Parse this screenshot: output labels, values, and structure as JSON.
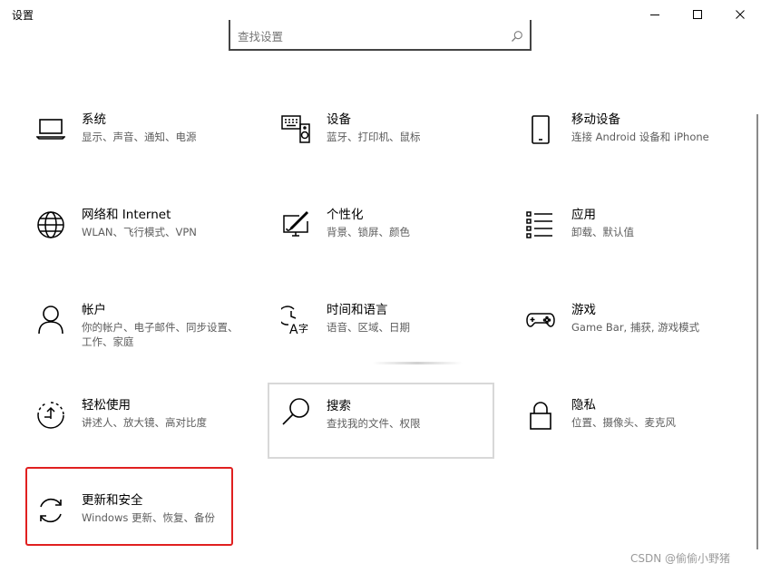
{
  "window": {
    "title": "设置",
    "minimize_icon": "minimize-icon",
    "maximize_icon": "maximize-icon",
    "close_icon": "close-icon"
  },
  "search": {
    "placeholder": "查找设置",
    "value": "",
    "icon": "search-icon"
  },
  "categories": [
    {
      "name": "系统",
      "desc": "显示、声音、通知、电源",
      "icon": "laptop-icon"
    },
    {
      "name": "设备",
      "desc": "蓝牙、打印机、鼠标",
      "icon": "keyboard-speaker-icon"
    },
    {
      "name": "移动设备",
      "desc": "连接 Android 设备和 iPhone",
      "icon": "phone-icon"
    },
    {
      "name": "网络和 Internet",
      "desc": "WLAN、飞行模式、VPN",
      "icon": "globe-icon"
    },
    {
      "name": "个性化",
      "desc": "背景、锁屏、颜色",
      "icon": "paint-monitor-icon"
    },
    {
      "name": "应用",
      "desc": "卸载、默认值",
      "icon": "apps-list-icon"
    },
    {
      "name": "帐户",
      "desc": "你的帐户、电子邮件、同步设置、工作、家庭",
      "icon": "person-icon"
    },
    {
      "name": "时间和语言",
      "desc": "语音、区域、日期",
      "icon": "time-language-icon"
    },
    {
      "name": "游戏",
      "desc": "Game Bar, 捕获, 游戏模式",
      "icon": "gamepad-icon"
    },
    {
      "name": "轻松使用",
      "desc": "讲述人、放大镜、高对比度",
      "icon": "ease-of-access-icon"
    },
    {
      "name": "搜索",
      "desc": "查找我的文件、权限",
      "icon": "magnifier-icon"
    },
    {
      "name": "隐私",
      "desc": "位置、摄像头、麦克风",
      "icon": "lock-icon"
    },
    {
      "name": "更新和安全",
      "desc": "Windows 更新、恢复、备份",
      "icon": "sync-icon"
    }
  ],
  "watermark": "CSDN @偷偷小野猪",
  "colors": {
    "highlight": "#e02020",
    "focus_border": "#d8d8d8",
    "secondary_text": "#5d5d5d"
  }
}
